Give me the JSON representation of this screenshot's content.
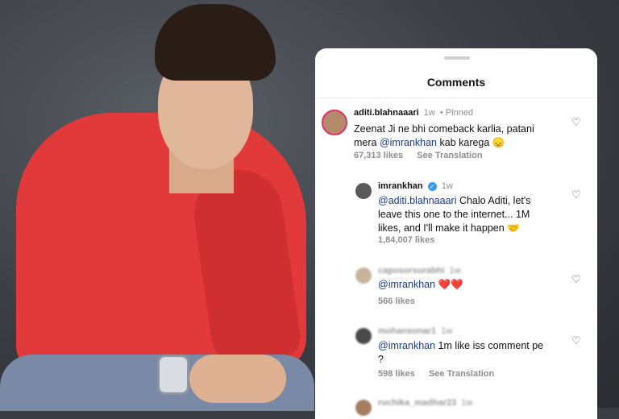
{
  "panel": {
    "title": "Comments"
  },
  "comments": [
    {
      "username": "aditi.blahnaaari",
      "time": "1w",
      "pinned": "• Pinned",
      "text_before": "Zeenat Ji ne bhi comeback karlia, patani mera ",
      "mention": "@imrankhan",
      "text_after": " kab karega 😞",
      "likes": "67,313 likes",
      "see_translation": "See Translation"
    },
    {
      "username": "imrankhan",
      "verified": "✓",
      "time": "1w",
      "mention": "@aditi.blahnaaari",
      "text_after": " Chalo Aditi, let's leave this one to the internet... 1M likes, and I'll make it happen 🤝",
      "likes": "1,84,007 likes"
    },
    {
      "username": "caposorsurabhi",
      "time": "1w",
      "mention": "@imrankhan",
      "text_after": " ❤️❤️",
      "likes": "566 likes"
    },
    {
      "username": "mohansonar1",
      "time": "1w",
      "mention": "@imrankhan",
      "text_after": " 1m like iss comment pe ?",
      "likes": "598 likes",
      "see_translation": "See Translation"
    },
    {
      "username": "ruchika_madhar23",
      "time": "1w"
    }
  ],
  "icons": {
    "heart": "heart-outline-icon"
  }
}
